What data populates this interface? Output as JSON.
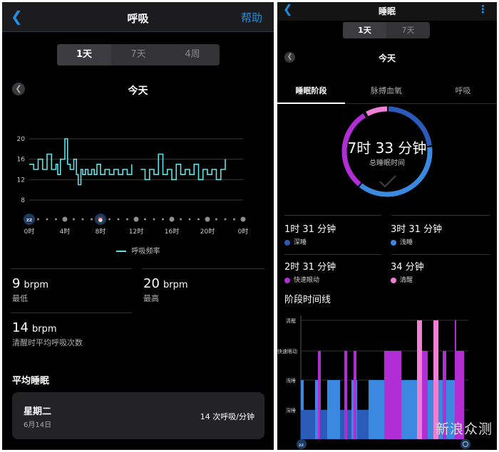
{
  "left": {
    "header": {
      "title": "呼吸",
      "help_label": "帮助"
    },
    "range_tabs": [
      "1天",
      "7天",
      "4周"
    ],
    "day_title": "今天",
    "chart": {
      "y_ticks": [
        "20",
        "16",
        "12",
        "8"
      ],
      "x_ticks": [
        "0时",
        "4时",
        "8时",
        "12时",
        "16时",
        "20时",
        "0时"
      ],
      "legend": "呼吸频率"
    },
    "chart_data": {
      "type": "line",
      "legend": "呼吸频率",
      "ylim": [
        8,
        20
      ],
      "x_range_hours": [
        0,
        24
      ],
      "segments": [
        {
          "x": [
            0,
            0.5,
            1,
            1.5,
            2,
            2.5,
            3,
            3.2,
            3.5,
            4,
            4.3,
            4.6,
            5,
            5.3,
            5.5,
            5.8,
            6,
            6.3,
            6.6,
            7,
            7.3,
            7.6,
            8,
            8.5,
            9,
            9.5,
            10,
            10.5,
            11,
            11.5
          ],
          "y": [
            15,
            14,
            16,
            14,
            17,
            14,
            15,
            13,
            16,
            20,
            15,
            14,
            16,
            13,
            11,
            14,
            13,
            14,
            13,
            14,
            13,
            15,
            13,
            14,
            13,
            14,
            13,
            14,
            13,
            15
          ]
        },
        {
          "x": [
            12.5,
            13,
            13.5,
            14,
            14.5,
            15,
            15.5,
            16,
            16.5,
            17,
            17.5,
            18,
            18.5,
            19,
            19.5,
            20,
            20.5,
            21,
            21.5,
            22
          ],
          "y": [
            14,
            12,
            14,
            13,
            17,
            13,
            14,
            12,
            15,
            13,
            14,
            13,
            15,
            12,
            14,
            13,
            14,
            12,
            14,
            16
          ]
        }
      ]
    },
    "stats": [
      {
        "value": "9",
        "unit": "brpm",
        "label": "最低"
      },
      {
        "value": "20",
        "unit": "brpm",
        "label": "最高"
      },
      {
        "value": "14",
        "unit": "brpm",
        "label": "清醒时平均呼吸次数"
      }
    ],
    "avg_sleep": {
      "title": "平均睡眠",
      "day": "星期二",
      "date": "6月14日",
      "value": "14 次呼吸/分钟"
    }
  },
  "right": {
    "header": {
      "title": "睡眠"
    },
    "range_tabs": [
      "1天",
      "7天"
    ],
    "day_title": "今天",
    "sub_tabs": [
      "睡眠阶段",
      "脉搏血氧",
      "呼吸"
    ],
    "ring": {
      "total": "7时 33 分钟",
      "label": "总睡眠时间"
    },
    "stages": [
      {
        "value": "1时 31 分钟",
        "label": "深睡",
        "color": "#2a5bb8"
      },
      {
        "value": "3时 31 分钟",
        "label": "浅睡",
        "color": "#3a88e0"
      },
      {
        "value": "2时 31 分钟",
        "label": "快速眼动",
        "color": "#b12ed4"
      },
      {
        "value": "34 分钟",
        "label": "清醒",
        "color": "#ef80d4"
      }
    ],
    "timeline": {
      "title": "阶段时间线",
      "levels": [
        "清醒",
        "快速眼动",
        "浅睡",
        "深睡"
      ]
    },
    "watermark": "新浪众测"
  }
}
